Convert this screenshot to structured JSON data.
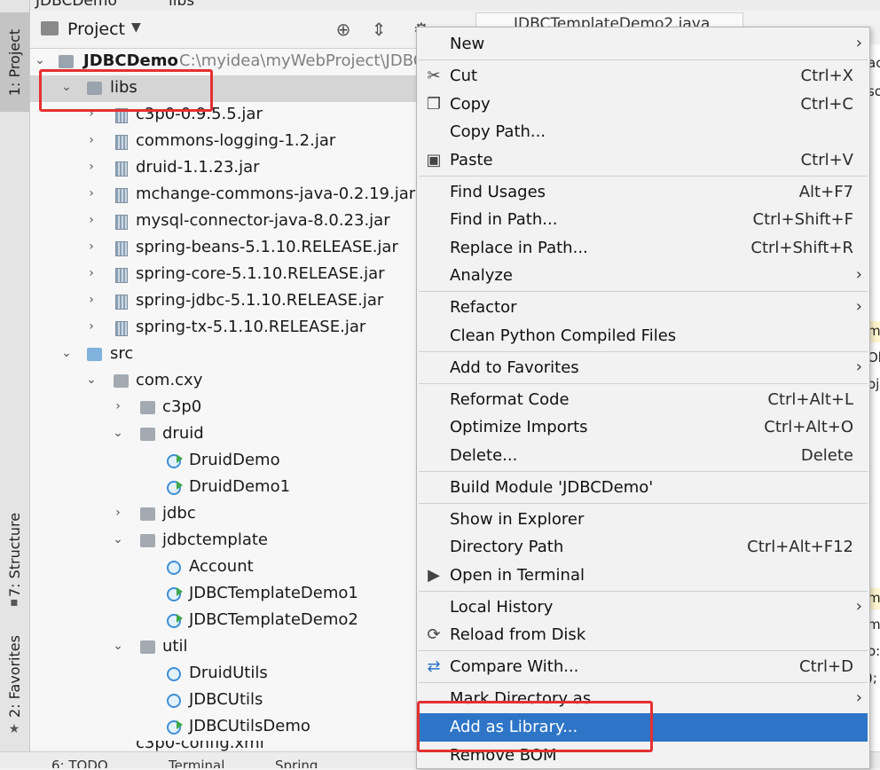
{
  "breadcrumb": {
    "project": "JDBCDemo",
    "folder": "libs"
  },
  "project_panel": {
    "title": "Project"
  },
  "editor_tab": {
    "label": "JDBCTemplateDemo2.java"
  },
  "left_strip": {
    "project": "1: Project",
    "structure": "7: Structure",
    "favorites": "2: Favorites"
  },
  "bottom_tabs": {
    "todo": "6: TODO",
    "terminal": "Terminal",
    "spring": "Spring"
  },
  "tree": {
    "root": {
      "name": "JDBCDemo",
      "path": "C:\\myidea\\myWebProject\\JDBC"
    },
    "libs": "libs",
    "jars": [
      "c3p0-0.9.5.5.jar",
      "commons-logging-1.2.jar",
      "druid-1.1.23.jar",
      "mchange-commons-java-0.2.19.jar",
      "mysql-connector-java-8.0.23.jar",
      "spring-beans-5.1.10.RELEASE.jar",
      "spring-core-5.1.10.RELEASE.jar",
      "spring-jdbc-5.1.10.RELEASE.jar",
      "spring-tx-5.1.10.RELEASE.jar"
    ],
    "src": "src",
    "pkg": "com.cxy",
    "c3p0": "c3p0",
    "druid": "druid",
    "druid_items": [
      "DruidDemo",
      "DruidDemo1"
    ],
    "jdbc": "jdbc",
    "jdbctemplate": "jdbctemplate",
    "jdbctemplate_items": [
      "Account",
      "JDBCTemplateDemo1",
      "JDBCTemplateDemo2"
    ],
    "util": "util",
    "util_items": [
      "DruidUtils",
      "JDBCUtils",
      "JDBCUtilsDemo"
    ],
    "config": "c3p0-config.xml"
  },
  "menu": {
    "new": "New",
    "cut": "Cut",
    "cut_key": "Ctrl+X",
    "copy": "Copy",
    "copy_key": "Ctrl+C",
    "copy_path": "Copy Path...",
    "paste": "Paste",
    "paste_key": "Ctrl+V",
    "find_usages": "Find Usages",
    "find_usages_key": "Alt+F7",
    "find_in_path": "Find in Path...",
    "find_in_path_key": "Ctrl+Shift+F",
    "replace_in_path": "Replace in Path...",
    "replace_in_path_key": "Ctrl+Shift+R",
    "analyze": "Analyze",
    "refactor": "Refactor",
    "clean_python": "Clean Python Compiled Files",
    "add_favorites": "Add to Favorites",
    "reformat": "Reformat Code",
    "reformat_key": "Ctrl+Alt+L",
    "optimize": "Optimize Imports",
    "optimize_key": "Ctrl+Alt+O",
    "delete": "Delete...",
    "delete_key": "Delete",
    "build_module": "Build Module 'JDBCDemo'",
    "show_explorer": "Show in Explorer",
    "directory_path": "Directory Path",
    "directory_path_key": "Ctrl+Alt+F12",
    "open_terminal": "Open in Terminal",
    "local_history": "Local History",
    "reload": "Reload from Disk",
    "compare": "Compare With...",
    "compare_key": "Ctrl+D",
    "mark_directory": "Mark Directory as",
    "add_library": "Add as Library...",
    "remove_bom": "Remove BOM"
  },
  "editor_fragments": [
    "ac",
    "so",
    "m",
    "Ob",
    "oj",
    "m",
    "ma",
    "o:",
    ");"
  ]
}
